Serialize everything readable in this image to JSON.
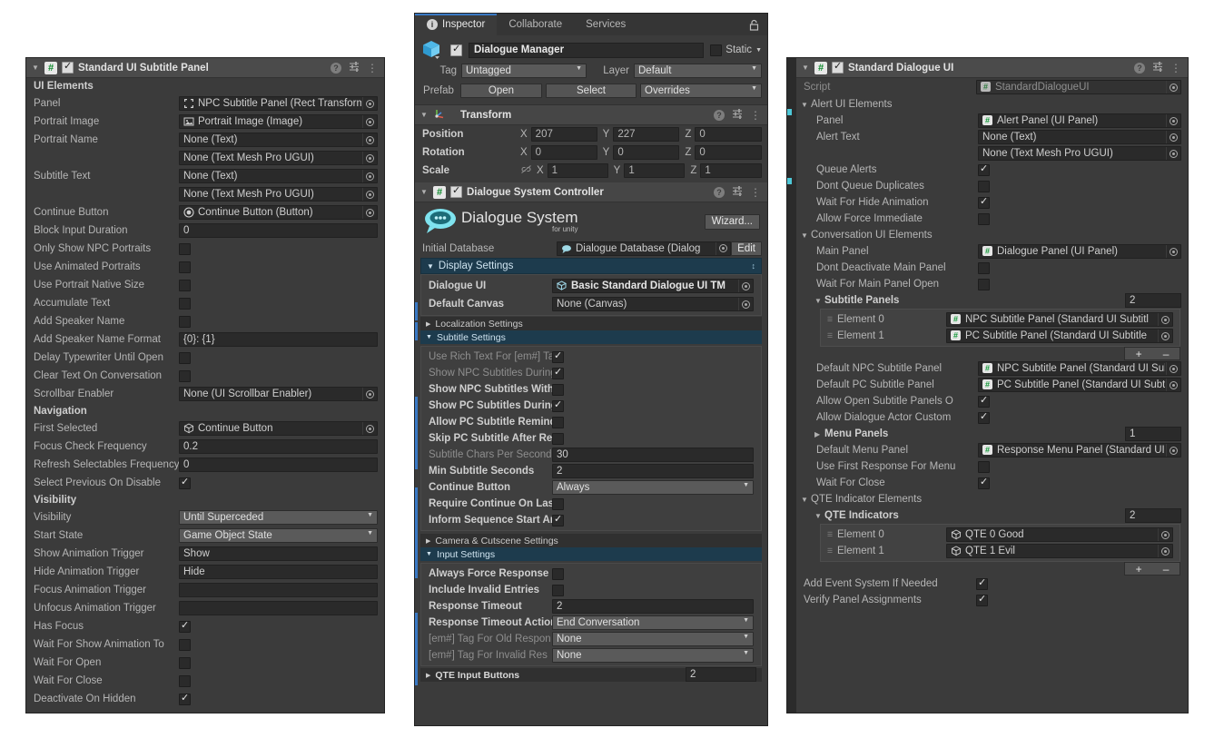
{
  "left_panel": {
    "header": {
      "title": "Standard UI Subtitle Panel",
      "enabled": true
    },
    "sections": [
      {
        "type": "header",
        "label": "UI Elements"
      },
      {
        "type": "obj",
        "label": "Panel",
        "value": "NPC Subtitle Panel (Rect Transform",
        "icon": "rect-transform-icon"
      },
      {
        "type": "obj",
        "label": "Portrait Image",
        "value": "Portrait Image (Image)",
        "icon": "image-icon"
      },
      {
        "type": "obj",
        "label": "Portrait Name",
        "value": "None (Text)",
        "icon": "none"
      },
      {
        "type": "obj",
        "label": "",
        "value": "None (Text Mesh Pro UGUI)",
        "icon": "none"
      },
      {
        "type": "obj",
        "label": "Subtitle Text",
        "value": "None (Text)",
        "icon": "none"
      },
      {
        "type": "obj",
        "label": "",
        "value": "None (Text Mesh Pro UGUI)",
        "icon": "none"
      },
      {
        "type": "obj",
        "label": "Continue Button",
        "value": "Continue Button (Button)",
        "icon": "button-icon"
      },
      {
        "type": "text",
        "label": "Block Input Duration",
        "value": "0"
      },
      {
        "type": "check",
        "label": "Only Show NPC Portraits",
        "checked": false
      },
      {
        "type": "check",
        "label": "Use Animated Portraits",
        "checked": false
      },
      {
        "type": "check",
        "label": "Use Portrait Native Size",
        "checked": false
      },
      {
        "type": "check",
        "label": "Accumulate Text",
        "checked": false
      },
      {
        "type": "check",
        "label": "Add Speaker Name",
        "checked": false
      },
      {
        "type": "text",
        "label": "Add Speaker Name Format",
        "value": "{0}: {1}"
      },
      {
        "type": "check",
        "label": "Delay Typewriter Until Open",
        "checked": false
      },
      {
        "type": "check",
        "label": "Clear Text On Conversation",
        "checked": false
      },
      {
        "type": "obj",
        "label": "Scrollbar Enabler",
        "value": "None (UI Scrollbar Enabler)",
        "icon": "none"
      },
      {
        "type": "header",
        "label": "Navigation"
      },
      {
        "type": "obj",
        "label": "First Selected",
        "value": "Continue Button",
        "icon": "gameobject-icon"
      },
      {
        "type": "text",
        "label": "Focus Check Frequency",
        "value": "0.2"
      },
      {
        "type": "text",
        "label": "Refresh Selectables Frequency",
        "value": "0"
      },
      {
        "type": "check",
        "label": "Select Previous On Disable",
        "checked": true
      },
      {
        "type": "header",
        "label": "Visibility"
      },
      {
        "type": "dropdown",
        "label": "Visibility",
        "value": "Until Superceded"
      },
      {
        "type": "dropdown",
        "label": "Start State",
        "value": "Game Object State"
      },
      {
        "type": "text",
        "label": "Show Animation Trigger",
        "value": "Show"
      },
      {
        "type": "text",
        "label": "Hide Animation Trigger",
        "value": "Hide"
      },
      {
        "type": "text",
        "label": "Focus Animation Trigger",
        "value": ""
      },
      {
        "type": "text",
        "label": "Unfocus Animation Trigger",
        "value": ""
      },
      {
        "type": "check",
        "label": "Has Focus",
        "checked": true
      },
      {
        "type": "check",
        "label": "Wait For Show Animation To",
        "checked": false
      },
      {
        "type": "check",
        "label": "Wait For Open",
        "checked": false
      },
      {
        "type": "check",
        "label": "Wait For Close",
        "checked": false
      },
      {
        "type": "check",
        "label": "Deactivate On Hidden",
        "checked": true
      }
    ]
  },
  "mid_panel": {
    "tabs": [
      {
        "label": "Inspector",
        "active": true,
        "icon": "info-icon"
      },
      {
        "label": "Collaborate",
        "active": false
      },
      {
        "label": "Services",
        "active": false
      }
    ],
    "lock_icon": "lock-icon",
    "gameobject": {
      "name": "Dialogue Manager",
      "enabled": true,
      "static_label": "Static",
      "static_checked": false,
      "tag_label": "Tag",
      "tag_value": "Untagged",
      "layer_label": "Layer",
      "layer_value": "Default",
      "prefab_label": "Prefab",
      "open_label": "Open",
      "select_label": "Select",
      "overrides_label": "Overrides"
    },
    "transform": {
      "title": "Transform",
      "rows": [
        {
          "label": "Position",
          "x": "207",
          "y": "227",
          "z": "0"
        },
        {
          "label": "Rotation",
          "x": "0",
          "y": "0",
          "z": "0"
        },
        {
          "label": "Scale",
          "x": "1",
          "y": "1",
          "z": "1",
          "link_icon": "unlink-icon"
        }
      ]
    },
    "controller": {
      "title": "Dialogue System Controller",
      "enabled": true,
      "logo_main": "Dialogue System",
      "logo_sub": "for unity",
      "wizard_label": "Wizard...",
      "initial_database_label": "Initial Database",
      "initial_database_value": "Dialogue Database (Dialog",
      "edit_label": "Edit",
      "display_settings_label": "Display Settings",
      "dialogue_ui_label": "Dialogue UI",
      "dialogue_ui_value": "Basic Standard Dialogue UI TM",
      "default_canvas_label": "Default Canvas",
      "default_canvas_value": "None (Canvas)",
      "localization_settings_label": "Localization Settings",
      "subtitle_settings_label": "Subtitle Settings",
      "subtitle_rows": [
        {
          "type": "check",
          "label": "Use Rich Text For [em#] Ta",
          "checked": true,
          "dim": true
        },
        {
          "type": "check",
          "label": "Show NPC Subtitles During",
          "checked": true,
          "dim": true
        },
        {
          "type": "check",
          "label": "Show NPC Subtitles With",
          "checked": false
        },
        {
          "type": "check",
          "label": "Show PC Subtitles During",
          "checked": true
        },
        {
          "type": "check",
          "label": "Allow PC Subtitle Reminder",
          "checked": false
        },
        {
          "type": "check",
          "label": "Skip PC Subtitle After Res",
          "checked": false
        },
        {
          "type": "text",
          "label": "Subtitle Chars Per Second",
          "value": "30",
          "dim": true
        },
        {
          "type": "text",
          "label": "Min Subtitle Seconds",
          "value": "2"
        },
        {
          "type": "dropdown",
          "label": "Continue Button",
          "value": "Always"
        },
        {
          "type": "check",
          "label": "Require Continue On Last",
          "checked": false
        },
        {
          "type": "check",
          "label": "Inform Sequence Start And",
          "checked": true
        }
      ],
      "camera_settings_label": "Camera & Cutscene Settings",
      "input_settings_label": "Input Settings",
      "input_rows": [
        {
          "type": "check",
          "label": "Always Force Response M",
          "checked": false
        },
        {
          "type": "check",
          "label": "Include Invalid Entries",
          "checked": false
        },
        {
          "type": "text",
          "label": "Response Timeout",
          "value": "2"
        },
        {
          "type": "dropdown",
          "label": "Response Timeout Action",
          "value": "End Conversation"
        },
        {
          "type": "dropdown",
          "label": "[em#] Tag For Old Respon",
          "value": "None",
          "dim": true
        },
        {
          "type": "dropdown",
          "label": "[em#] Tag For Invalid Res",
          "value": "None",
          "dim": true
        }
      ],
      "qte_input_buttons_label": "QTE Input Buttons",
      "qte_input_buttons_count": "2"
    }
  },
  "right_panel": {
    "header": {
      "title": "Standard Dialogue UI",
      "enabled": true
    },
    "script_label": "Script",
    "script_value": "StandardDialogueUI",
    "rows": [
      {
        "type": "foldout",
        "label": "Alert UI Elements",
        "open": true,
        "indent": 0
      },
      {
        "type": "obj",
        "label": "Panel",
        "value": "Alert Panel (UI Panel)",
        "icon": "script-icon",
        "indent": 1
      },
      {
        "type": "obj",
        "label": "Alert Text",
        "value": "None (Text)",
        "icon": "none",
        "indent": 1,
        "narrow": true
      },
      {
        "type": "obj",
        "label": "",
        "value": "None (Text Mesh Pro UGUI)",
        "icon": "none",
        "indent": 1,
        "narrow": true
      },
      {
        "type": "check",
        "label": "Queue Alerts",
        "checked": true,
        "indent": 1
      },
      {
        "type": "check",
        "label": "Dont Queue Duplicates",
        "checked": false,
        "indent": 1
      },
      {
        "type": "check",
        "label": "Wait For Hide Animation",
        "checked": true,
        "indent": 1
      },
      {
        "type": "check",
        "label": "Allow Force Immediate",
        "checked": false,
        "indent": 1
      },
      {
        "type": "foldout",
        "label": "Conversation UI Elements",
        "open": true,
        "indent": 0
      },
      {
        "type": "obj",
        "label": "Main Panel",
        "value": "Dialogue Panel (UI Panel)",
        "icon": "script-icon",
        "indent": 1
      },
      {
        "type": "check",
        "label": "Dont Deactivate Main Panel",
        "checked": false,
        "indent": 1
      },
      {
        "type": "check",
        "label": "Wait For Main Panel Open",
        "checked": false,
        "indent": 1
      },
      {
        "type": "array",
        "label": "Subtitle Panels",
        "count": "2",
        "indent": 1,
        "open": true,
        "elements": [
          {
            "label": "Element 0",
            "value": "NPC Subtitle Panel (Standard UI Subtitl",
            "icon": "script-icon"
          },
          {
            "label": "Element 1",
            "value": "PC Subtitle Panel (Standard UI Subtitle",
            "icon": "script-icon"
          }
        ]
      },
      {
        "type": "obj",
        "label": "Default NPC Subtitle Panel",
        "value": "NPC Subtitle Panel (Standard UI Subtitle",
        "icon": "script-icon",
        "indent": 1
      },
      {
        "type": "obj",
        "label": "Default PC Subtitle Panel",
        "value": "PC Subtitle Panel (Standard UI Subtitle P",
        "icon": "script-icon",
        "indent": 1
      },
      {
        "type": "check",
        "label": "Allow Open Subtitle Panels O",
        "checked": true,
        "indent": 1
      },
      {
        "type": "check",
        "label": "Allow Dialogue Actor Custom",
        "checked": true,
        "indent": 1
      },
      {
        "type": "arrayclosed",
        "label": "Menu Panels",
        "count": "1",
        "indent": 1
      },
      {
        "type": "obj",
        "label": "Default Menu Panel",
        "value": "Response Menu Panel (Standard UI Men",
        "icon": "script-icon",
        "indent": 1
      },
      {
        "type": "check",
        "label": "Use First Response For Menu",
        "checked": false,
        "indent": 1
      },
      {
        "type": "check",
        "label": "Wait For Close",
        "checked": true,
        "indent": 1
      },
      {
        "type": "foldout",
        "label": "QTE Indicator Elements",
        "open": true,
        "indent": 0
      },
      {
        "type": "array",
        "label": "QTE Indicators",
        "count": "2",
        "indent": 1,
        "open": true,
        "elements": [
          {
            "label": "Element 0",
            "value": "QTE 0 Good",
            "icon": "gameobject-icon"
          },
          {
            "label": "Element 1",
            "value": "QTE 1 Evil",
            "icon": "gameobject-icon"
          }
        ]
      },
      {
        "type": "check",
        "label": "Add Event System If Needed",
        "checked": true,
        "indent": 0
      },
      {
        "type": "check",
        "label": "Verify Panel Assignments",
        "checked": true,
        "indent": 0
      }
    ],
    "array_add_label": "+",
    "array_remove_label": "–"
  },
  "colors": {
    "panel_bg": "#3b3b3b",
    "header_bg": "#4b3b3b",
    "field_bg": "#2a2a2a",
    "accent_blue": "#3a79c4",
    "section_blue": "#1d3b4d",
    "script_green": "#0f8a2e",
    "override_cyan": "#4ec8d8"
  }
}
